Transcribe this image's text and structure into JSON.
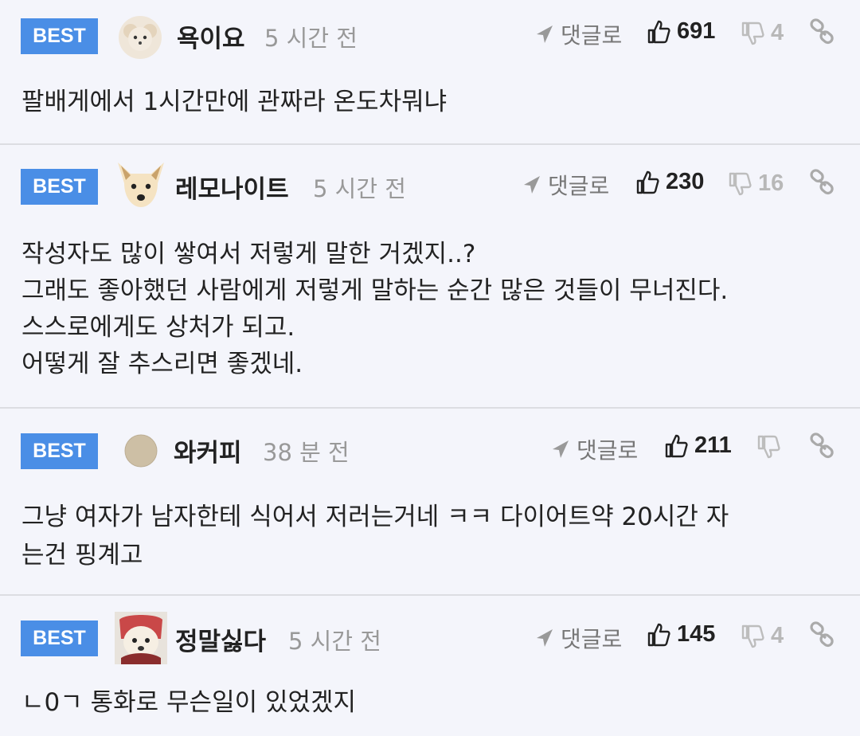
{
  "common": {
    "badge": "BEST",
    "reply_label": "댓글로"
  },
  "comments": [
    {
      "nickname": "욕이요",
      "time": "5 시간 전",
      "likes": "691",
      "dislikes": "4",
      "text": "팔배게에서 1시간만에 관짜라 온도차뭐냐"
    },
    {
      "nickname": "레모나이트",
      "time": "5 시간 전",
      "likes": "230",
      "dislikes": "16",
      "text": "작성자도 많이 쌓여서 저렇게 말한 거겠지..?\n그래도 좋아했던 사람에게 저렇게 말하는 순간 많은 것들이 무너진다.\n스스로에게도 상처가 되고.\n어떻게 잘 추스리면 좋겠네."
    },
    {
      "nickname": "와커피",
      "time": "38 분 전",
      "likes": "211",
      "dislikes": "",
      "text": "그냥 여자가 남자한테 식어서 저러는거네 ㅋㅋ 다이어트약 20시간 자\n는건 핑계고"
    },
    {
      "nickname": "정말싫다",
      "time": "5 시간 전",
      "likes": "145",
      "dislikes": "4",
      "text": "ㄴ0ㄱ 통화로 무슨일이 있었겠지"
    }
  ]
}
